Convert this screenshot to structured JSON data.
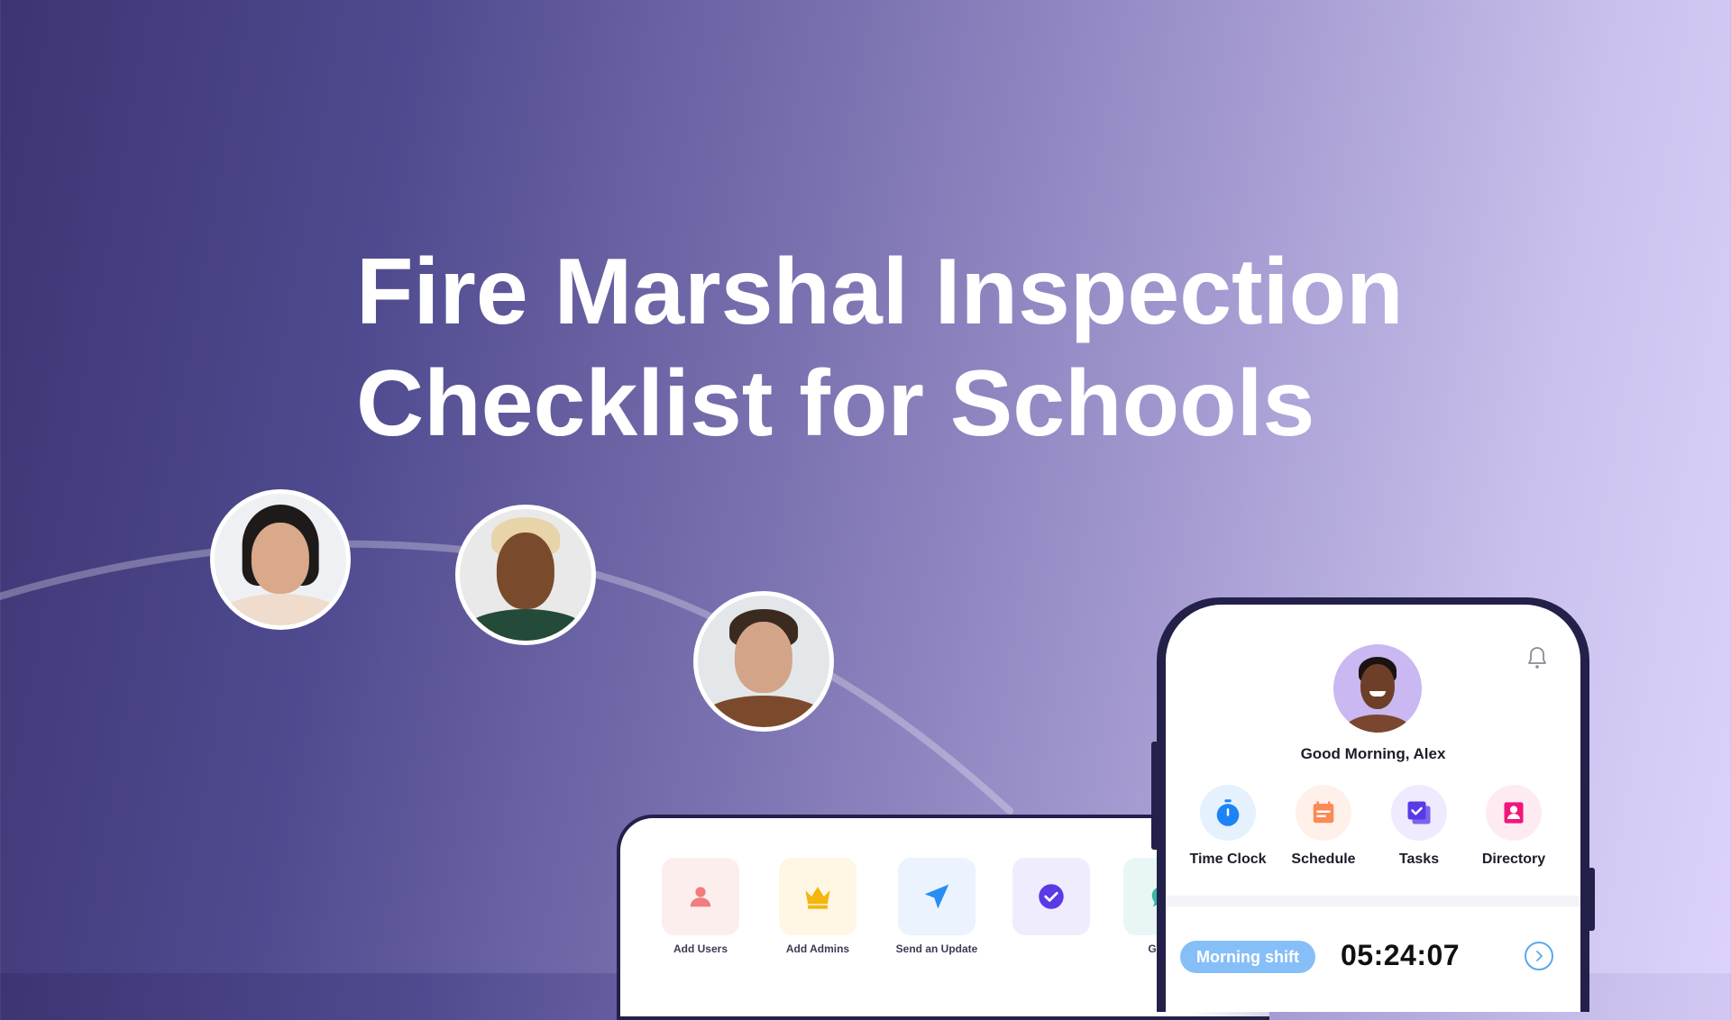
{
  "hero": {
    "title_line1": "Fire Marshal Inspection",
    "title_line2": "Checklist for Schools"
  },
  "team_avatars": [
    {
      "name": "avatar-woman-turtleneck"
    },
    {
      "name": "avatar-woman-blonde"
    },
    {
      "name": "avatar-man-glasses"
    }
  ],
  "tablet": {
    "actions": [
      {
        "label": "Add Users",
        "icon": "user-icon",
        "bg": "#fdeeee",
        "color": "#f27c7c"
      },
      {
        "label": "Add Admins",
        "icon": "crown-icon",
        "bg": "#fff6e3",
        "color": "#f5b50f"
      },
      {
        "label": "Send an Update",
        "icon": "send-icon",
        "bg": "#eaf3fe",
        "color": "#2b8cf2"
      },
      {
        "label": "",
        "icon": "check-circle-icon",
        "bg": "#efedfd",
        "color": "#5b39e6"
      },
      {
        "label": "Go to",
        "icon": "chat-icon",
        "bg": "#e8f7f5",
        "color": "#3bb7a5"
      }
    ]
  },
  "phone": {
    "greeting": "Good Morning, Alex",
    "quick_actions": [
      {
        "label": "Time Clock",
        "icon": "stopwatch-icon",
        "bg": "#e6f1fe",
        "color": "#1c84f6"
      },
      {
        "label": "Schedule",
        "icon": "calendar-icon",
        "bg": "#fff0e9",
        "color": "#fb8a56"
      },
      {
        "label": "Tasks",
        "icon": "tasks-icon",
        "bg": "#efeafd",
        "color": "#5a3ae6"
      },
      {
        "label": "Directory",
        "icon": "contact-icon",
        "bg": "#fdebf1",
        "color": "#f2167a"
      }
    ],
    "shift_label": "Morning shift",
    "shift_timer": "05:24:07"
  }
}
